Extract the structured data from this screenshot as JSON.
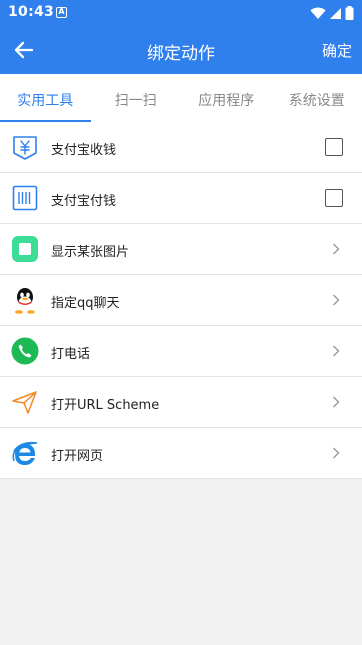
{
  "status_bar": {
    "time": "10:43",
    "app_icon_letter": "A"
  },
  "app_bar": {
    "title": "绑定动作",
    "confirm_label": "确定"
  },
  "tabs": [
    {
      "label": "实用工具",
      "active": true
    },
    {
      "label": "扫一扫",
      "active": false
    },
    {
      "label": "应用程序",
      "active": false
    },
    {
      "label": "系统设置",
      "active": false
    }
  ],
  "list": [
    {
      "label": "支付宝收钱",
      "icon": "alipay-receive-icon",
      "control": "checkbox",
      "checked": false
    },
    {
      "label": "支付宝付钱",
      "icon": "alipay-pay-icon",
      "control": "checkbox",
      "checked": false
    },
    {
      "label": "显示某张图片",
      "icon": "image-icon",
      "control": "chevron"
    },
    {
      "label": "指定qq聊天",
      "icon": "qq-icon",
      "control": "chevron"
    },
    {
      "label": "打电话",
      "icon": "phone-icon",
      "control": "chevron"
    },
    {
      "label": "打开URL Scheme",
      "icon": "paper-plane-icon",
      "control": "chevron"
    },
    {
      "label": "打开网页",
      "icon": "browser-icon",
      "control": "chevron"
    }
  ],
  "colors": {
    "primary": "#2f80ed",
    "background": "#f2f2f2",
    "phone_green": "#1db954",
    "image_teal": "#3ddc97"
  }
}
